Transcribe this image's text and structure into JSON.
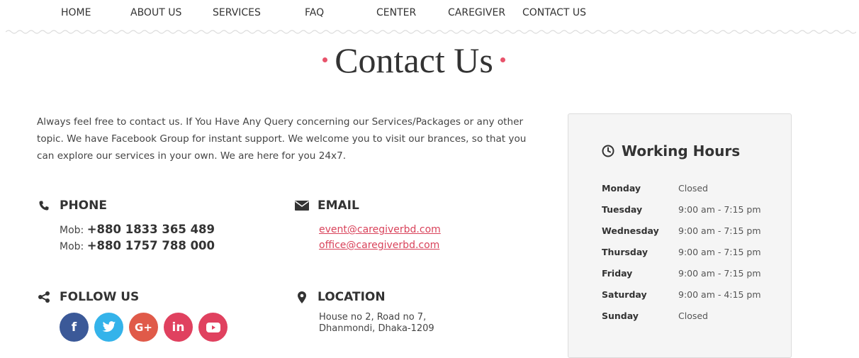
{
  "nav": {
    "items": [
      {
        "label": "HOME"
      },
      {
        "label": "ABOUT US"
      },
      {
        "label": "SERVICES"
      },
      {
        "label": "FAQ"
      },
      {
        "label": "CENTER"
      },
      {
        "label": "CAREGIVER"
      },
      {
        "label": "CONTACT US"
      }
    ]
  },
  "page": {
    "title": "Contact Us",
    "intro": "Always feel free to contact us. If You Have Any Query concerning our Services/Packages or any other topic. We have Facebook Group for instant support. We welcome you to visit our brances, so that you can explore our services in your own. We are here for you 24x7."
  },
  "phone": {
    "heading": "PHONE",
    "icon": "phone-icon",
    "lines": [
      {
        "prefix": "Mob: ",
        "number": "+880 1833 365 489"
      },
      {
        "prefix": "Mob: ",
        "number": "+880 1757 788 000"
      }
    ]
  },
  "email": {
    "heading": "EMAIL",
    "icon": "envelope-icon",
    "addresses": [
      "event@caregiverbd.com",
      "office@caregiverbd.com"
    ]
  },
  "follow": {
    "heading": "FOLLOW US",
    "icon": "share-icon",
    "networks": [
      {
        "name": "facebook",
        "glyph": "f",
        "color": "#3b5998"
      },
      {
        "name": "twitter",
        "glyph": "🐦",
        "color": "#34b3ea"
      },
      {
        "name": "google-plus",
        "glyph": "G+",
        "color": "#e05a49"
      },
      {
        "name": "linkedin",
        "glyph": "in",
        "color": "#e0415f"
      },
      {
        "name": "youtube",
        "glyph": "▶",
        "color": "#e0415f"
      }
    ]
  },
  "location": {
    "heading": "LOCATION",
    "icon": "map-marker-icon",
    "line1": "House no 2, Road no 7,",
    "line2": "Dhanmondi, Dhaka-1209"
  },
  "hours": {
    "title": "Working Hours",
    "icon": "clock-icon",
    "rows": [
      {
        "day": "Monday",
        "time": "Closed"
      },
      {
        "day": "Tuesday",
        "time": "9:00 am - 7:15 pm"
      },
      {
        "day": "Wednesday",
        "time": "9:00 am - 7:15 pm"
      },
      {
        "day": "Thursday",
        "time": "9:00 am - 7:15 pm"
      },
      {
        "day": "Friday",
        "time": "9:00 am - 7:15 pm"
      },
      {
        "day": "Saturday",
        "time": "9:00 am - 4:15 pm"
      },
      {
        "day": "Sunday",
        "time": "Closed"
      }
    ]
  },
  "colors": {
    "accent": "#e8536b",
    "link": "#d9435b",
    "panel_bg": "#f5f5f5"
  }
}
